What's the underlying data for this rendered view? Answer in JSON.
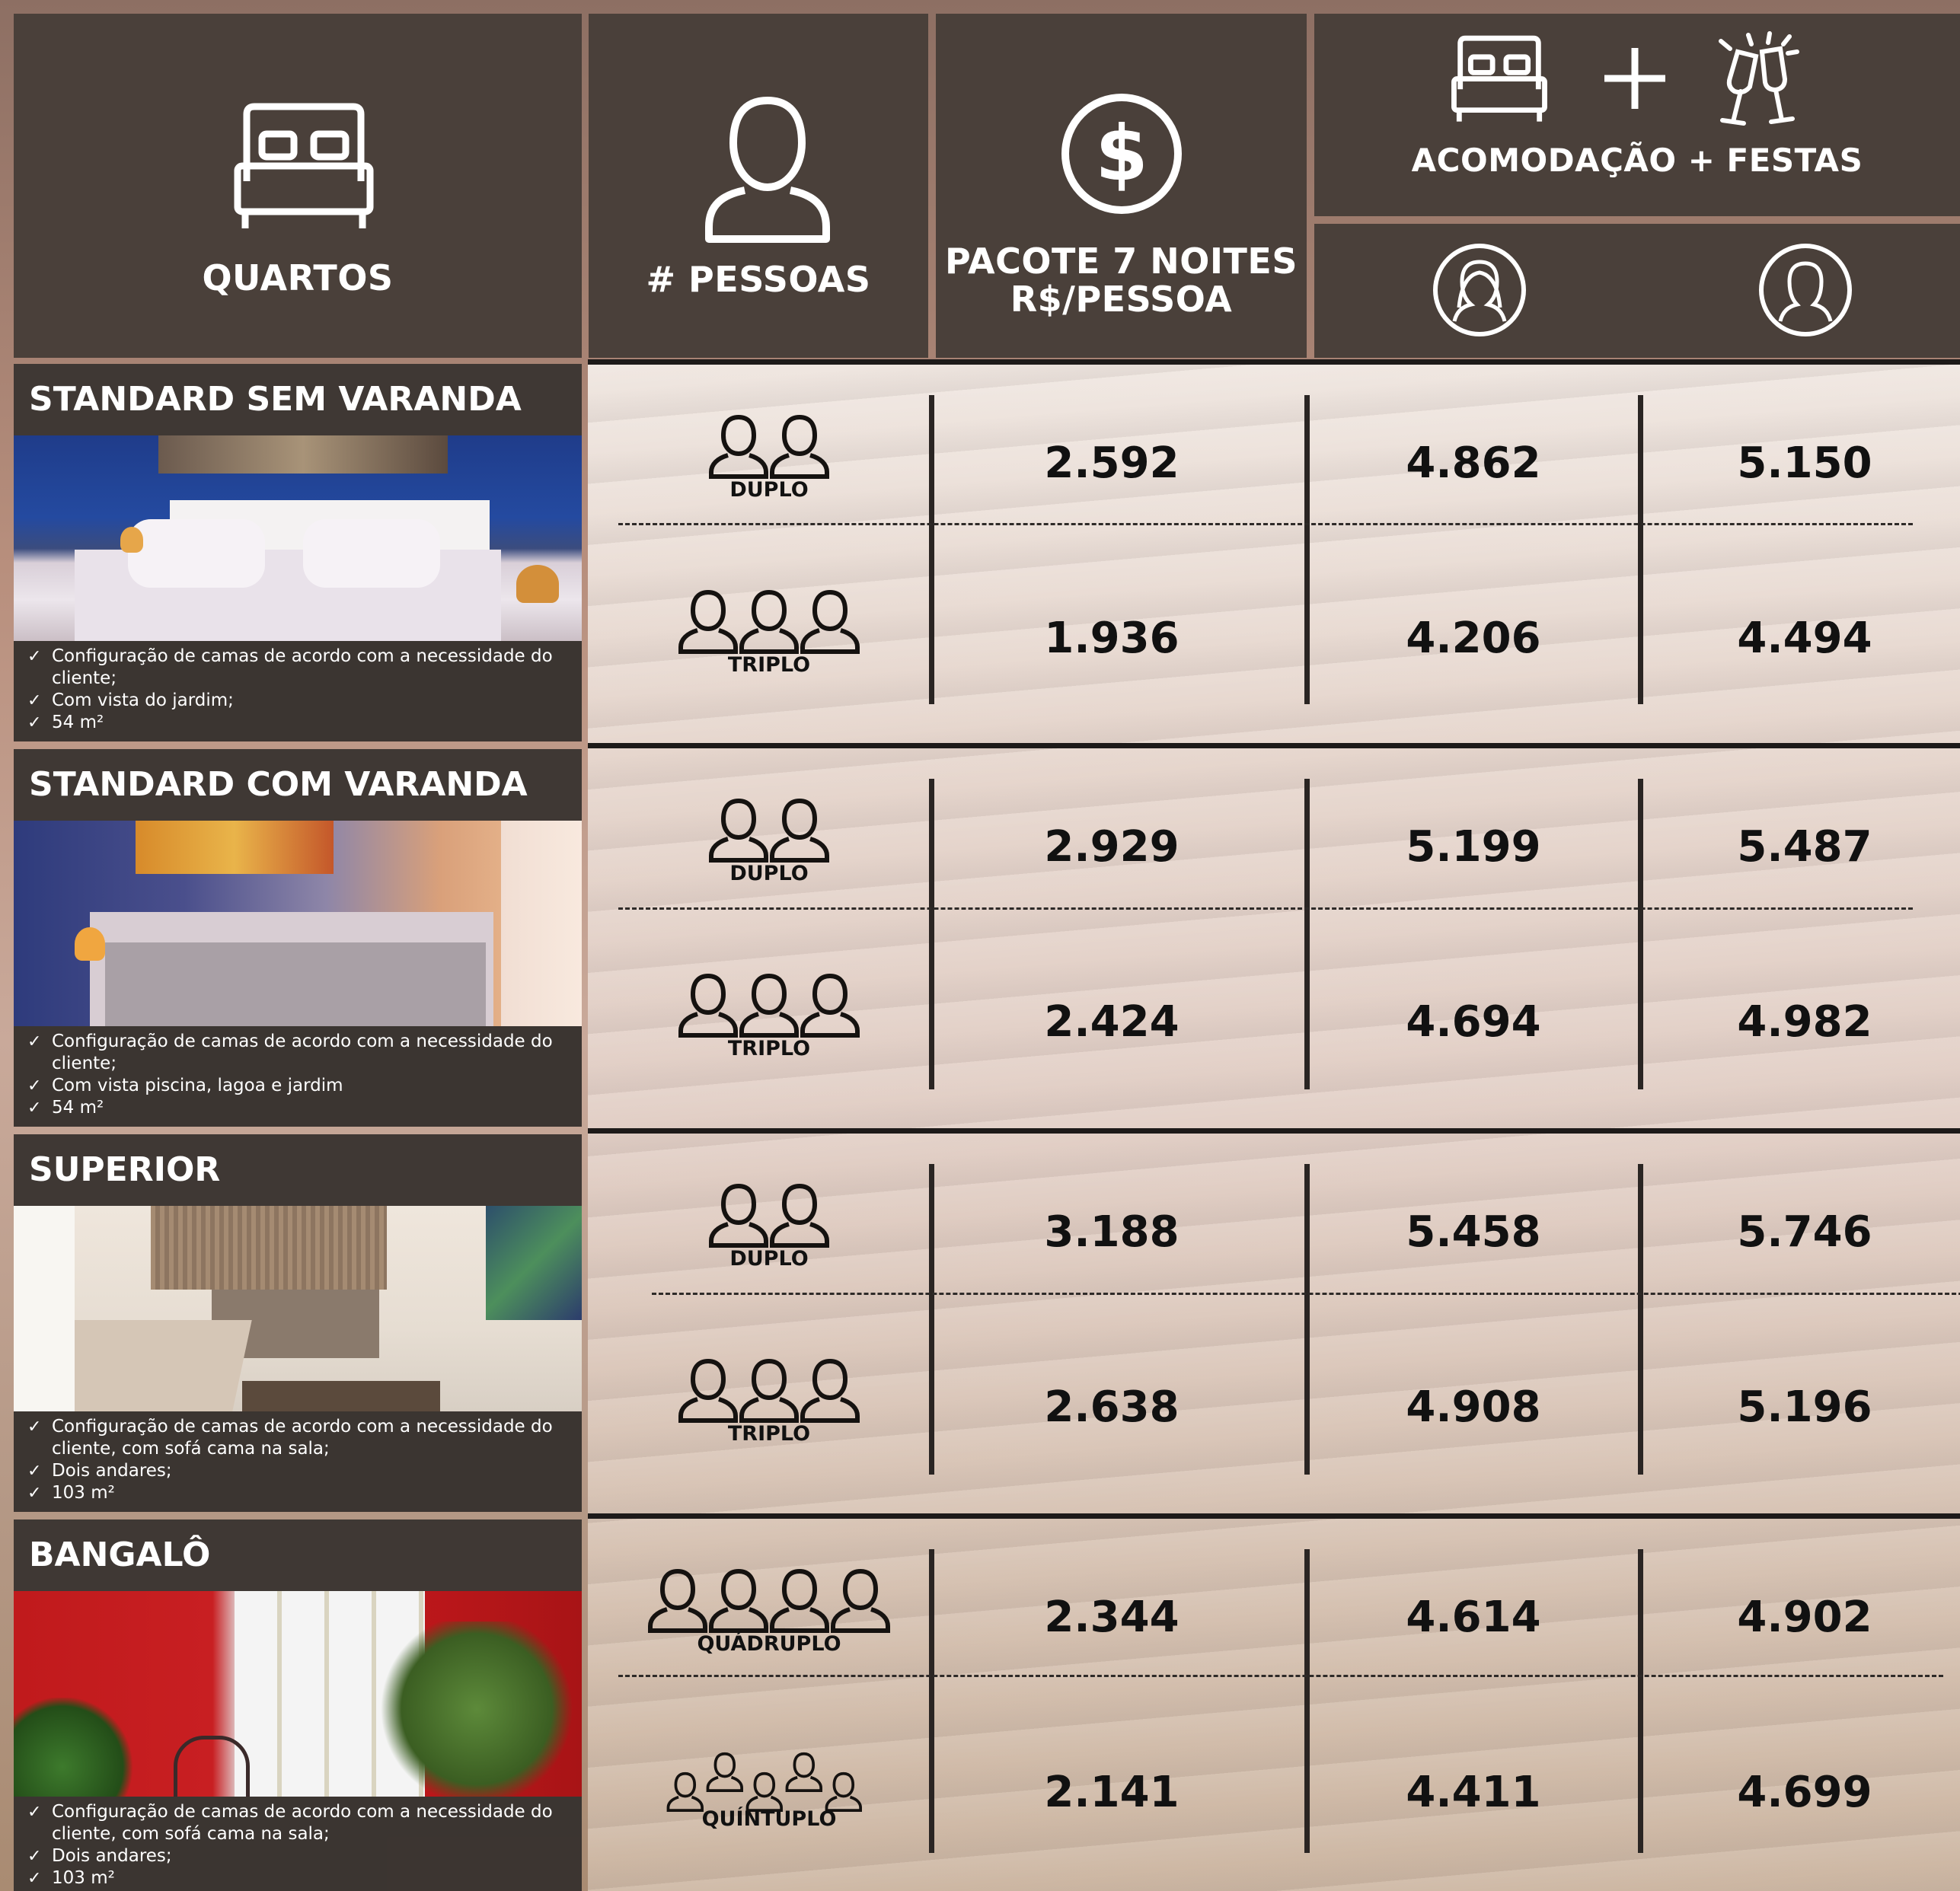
{
  "header": {
    "quartos": "QUARTOS",
    "pessoas": "# PESSOAS",
    "pacote_line1": "PACOTE 7 NOITES",
    "pacote_line2": "R$/PESSOA",
    "acomodacao": "ACOMODAÇÃO + FESTAS",
    "icons": [
      "bed-icon",
      "person-icon",
      "dollar-icon",
      "bed-icon",
      "plus-icon",
      "champagne-icon",
      "female-avatar-icon",
      "male-avatar-icon"
    ]
  },
  "rooms": [
    {
      "name": "STANDARD SEM VARANDA",
      "notes": [
        "Configuração de camas de acordo com a necessidade do cliente;",
        "Com vista do jardim;",
        "54 m²"
      ],
      "rows": [
        {
          "type": "DUPLO",
          "people": 2,
          "pacote": "2.592",
          "fem": "4.862",
          "masc": "5.150"
        },
        {
          "type": "TRIPLO",
          "people": 3,
          "pacote": "1.936",
          "fem": "4.206",
          "masc": "4.494"
        }
      ]
    },
    {
      "name": "STANDARD COM VARANDA",
      "notes": [
        "Configuração de camas de acordo com a necessidade do cliente;",
        "Com vista piscina, lagoa e jardim",
        "54 m²"
      ],
      "rows": [
        {
          "type": "DUPLO",
          "people": 2,
          "pacote": "2.929",
          "fem": "5.199",
          "masc": "5.487"
        },
        {
          "type": "TRIPLO",
          "people": 3,
          "pacote": "2.424",
          "fem": "4.694",
          "masc": "4.982"
        }
      ]
    },
    {
      "name": "SUPERIOR",
      "notes": [
        "Configuração de camas de acordo com a necessidade do cliente, com sofá cama na sala;",
        "Dois andares;",
        "103 m²"
      ],
      "rows": [
        {
          "type": "DUPLO",
          "people": 2,
          "pacote": "3.188",
          "fem": "5.458",
          "masc": "5.746"
        },
        {
          "type": "TRIPLO",
          "people": 3,
          "pacote": "2.638",
          "fem": "4.908",
          "masc": "5.196"
        }
      ]
    },
    {
      "name": "BANGALÔ",
      "notes": [
        "Configuração de camas de acordo com a necessidade do cliente, com sofá cama na sala;",
        "Dois andares;",
        "103 m²"
      ],
      "rows": [
        {
          "type": "QUÁDRUPLO",
          "people": 4,
          "pacote": "2.344",
          "fem": "4.614",
          "masc": "4.902"
        },
        {
          "type": "QUÍNTUPLO",
          "people": 5,
          "pacote": "2.141",
          "fem": "4.411",
          "masc": "4.699"
        }
      ]
    }
  ]
}
